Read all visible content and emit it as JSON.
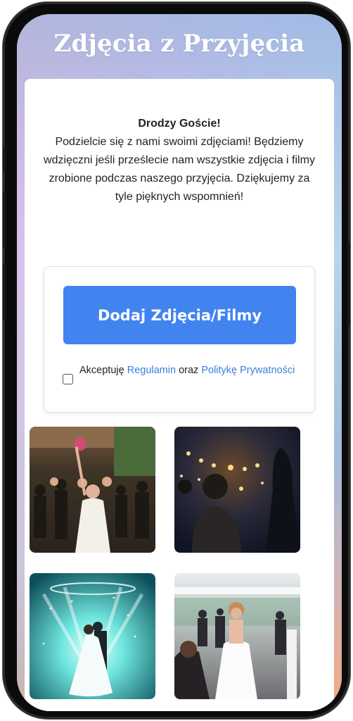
{
  "header": {
    "title": "Zdjęcia z Przyjęcia"
  },
  "welcome": {
    "greeting": "Drodzy Goście!",
    "message": "Podzielcie się z nami swoimi zdjęciami! Będziemy wdzięczni jeśli prześlecie nam wszystkie zdjęcia i filmy zrobione podczas naszego przyjęcia. Dziękujemy za tyle pięknych wspomnień!"
  },
  "upload": {
    "button_label": "Dodaj Zdjęcia/Filmy",
    "consent": {
      "prefix": "Akceptuję",
      "terms_link": "Regulamin",
      "joiner": "oraz",
      "privacy_link": "Politykę Prywatności",
      "checked": false
    }
  },
  "gallery": {
    "photos": [
      {
        "subject": "bride-bouquet-toss-crowd"
      },
      {
        "subject": "evening-string-lights-couple"
      },
      {
        "subject": "first-dance-light-show"
      },
      {
        "subject": "laughing-bride-with-guests"
      }
    ]
  },
  "colors": {
    "accent": "#4184f0",
    "link": "#3c7fd8",
    "title_text": "#ffffff",
    "background_gradient": [
      "#8fc1e4",
      "#d9c2ea",
      "#f7b8d9",
      "#f2b28a"
    ]
  }
}
